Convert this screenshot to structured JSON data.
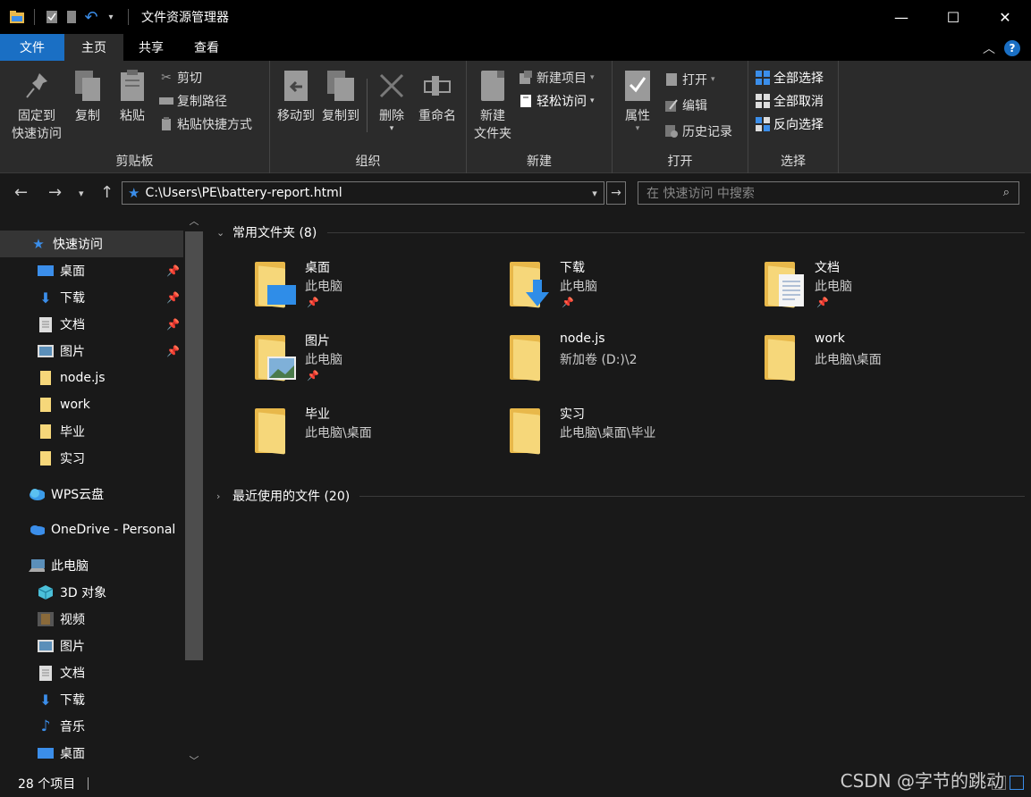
{
  "window": {
    "title": "文件资源管理器",
    "minimize": "—",
    "maximize": "☐",
    "close": "✕"
  },
  "ribbon_tabs": {
    "file": "文件",
    "home": "主页",
    "share": "共享",
    "view": "查看"
  },
  "ribbon": {
    "clipboard": {
      "label": "剪贴板",
      "pin": "固定到\n快速访问",
      "pin_line1": "固定到",
      "pin_line2": "快速访问",
      "copy": "复制",
      "paste": "粘贴",
      "cut": "剪切",
      "copy_path": "复制路径",
      "paste_shortcut": "粘贴快捷方式"
    },
    "organize": {
      "label": "组织",
      "move_to": "移动到",
      "copy_to": "复制到",
      "delete": "删除",
      "rename": "重命名"
    },
    "new": {
      "label": "新建",
      "new_folder_line1": "新建",
      "new_folder_line2": "文件夹",
      "new_item": "新建项目",
      "easy_access": "轻松访问"
    },
    "open": {
      "label": "打开",
      "properties": "属性",
      "open": "打开",
      "edit": "编辑",
      "history": "历史记录"
    },
    "select": {
      "label": "选择",
      "select_all": "全部选择",
      "select_none": "全部取消",
      "invert": "反向选择"
    }
  },
  "address": {
    "path": "C:\\Users\\PE\\battery-report.html",
    "search_placeholder": "在 快速访问 中搜索"
  },
  "nav": {
    "quick_access": "快速访问",
    "items": [
      {
        "label": "桌面",
        "pinned": true
      },
      {
        "label": "下载",
        "pinned": true
      },
      {
        "label": "文档",
        "pinned": true
      },
      {
        "label": "图片",
        "pinned": true
      },
      {
        "label": "node.js",
        "pinned": false
      },
      {
        "label": "work",
        "pinned": false
      },
      {
        "label": "毕业",
        "pinned": false
      },
      {
        "label": "实习",
        "pinned": false
      }
    ],
    "wps": "WPS云盘",
    "onedrive": "OneDrive - Personal",
    "this_pc": "此电脑",
    "pc_items": [
      {
        "label": "3D 对象"
      },
      {
        "label": "视频"
      },
      {
        "label": "图片"
      },
      {
        "label": "文档"
      },
      {
        "label": "下载"
      },
      {
        "label": "音乐"
      },
      {
        "label": "桌面"
      }
    ]
  },
  "content": {
    "frequent_header": "常用文件夹 (8)",
    "recent_header": "最近使用的文件 (20)",
    "folders": [
      {
        "name": "桌面",
        "location": "此电脑",
        "pinned": true
      },
      {
        "name": "下载",
        "location": "此电脑",
        "pinned": true
      },
      {
        "name": "文档",
        "location": "此电脑",
        "pinned": true
      },
      {
        "name": "图片",
        "location": "此电脑",
        "pinned": true
      },
      {
        "name": "node.js",
        "location": "新加卷 (D:)\\2",
        "pinned": false
      },
      {
        "name": "work",
        "location": "此电脑\\桌面",
        "pinned": false
      },
      {
        "name": "毕业",
        "location": "此电脑\\桌面",
        "pinned": false
      },
      {
        "name": "实习",
        "location": "此电脑\\桌面\\毕业",
        "pinned": false
      }
    ]
  },
  "status": {
    "count": "28 个项目"
  },
  "watermark": "CSDN @字节的跳动",
  "colors": {
    "accent": "#1a6fc4",
    "folder": "#f6d77a",
    "background": "#191919"
  }
}
